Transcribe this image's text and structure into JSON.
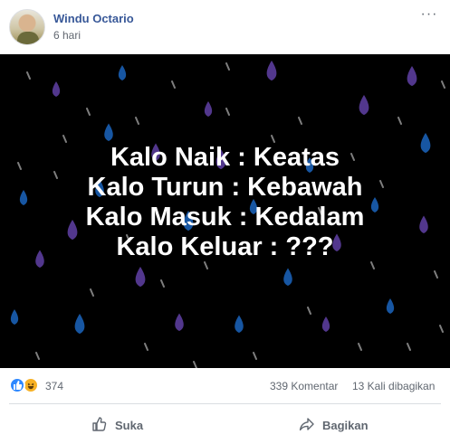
{
  "post": {
    "author": "Windu Octario",
    "time": "6 hari",
    "more_label": "···",
    "avatar_icon": "profile-photo"
  },
  "image": {
    "lines": [
      "Kalo Naik : Keatas",
      "Kalo Turun : Kebawah",
      "Kalo Masuk : Kedalam",
      "Kalo Keluar : ???"
    ],
    "colors": {
      "background": "#000000",
      "text": "#ffffff",
      "drop_purple": "#5b3d9c",
      "drop_blue": "#1a5fb4",
      "streak": "#a8a8a8"
    }
  },
  "stats": {
    "reaction_icons": [
      "like-reaction-icon",
      "haha-reaction-icon"
    ],
    "reaction_count": "374",
    "comments": "339 Komentar",
    "shares": "13 Kali dibagikan"
  },
  "actions": {
    "like_label": "Suka",
    "share_label": "Bagikan",
    "like_icon": "thumbs-up-icon",
    "share_icon": "share-arrow-icon"
  }
}
